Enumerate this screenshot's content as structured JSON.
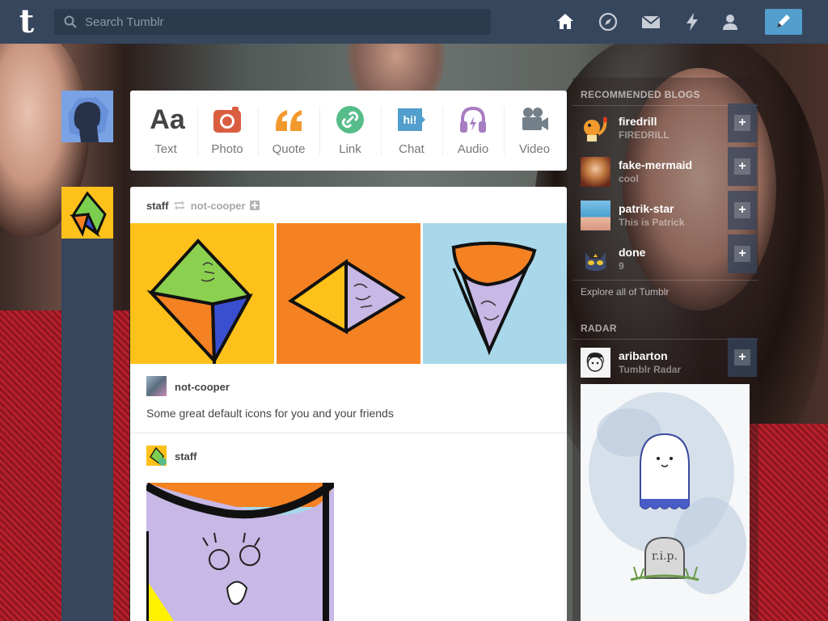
{
  "header": {
    "search_placeholder": "Search Tumblr",
    "logo_letter": "t"
  },
  "post_types": [
    {
      "label": "Text",
      "icon": "text-icon",
      "color": "#444444"
    },
    {
      "label": "Photo",
      "icon": "photo-icon",
      "color": "#d95e40"
    },
    {
      "label": "Quote",
      "icon": "quote-icon",
      "color": "#f2992e"
    },
    {
      "label": "Link",
      "icon": "link-icon",
      "color": "#56bc8a"
    },
    {
      "label": "Chat",
      "icon": "chat-icon",
      "color": "#529ecc"
    },
    {
      "label": "Audio",
      "icon": "audio-icon",
      "color": "#a77dc2"
    },
    {
      "label": "Video",
      "icon": "video-icon",
      "color": "#748089"
    }
  ],
  "post": {
    "author": "staff",
    "reblogged_from": "not-cooper",
    "source_name": "not-cooper",
    "body": "Some great default icons for you and your friends",
    "second_author": "staff"
  },
  "sidebar": {
    "recommended_title": "RECOMMENDED BLOGS",
    "blogs": [
      {
        "name": "firedrill",
        "subtitle": "FIREDRILL"
      },
      {
        "name": "fake-mermaid",
        "subtitle": "cool"
      },
      {
        "name": "patrik-star",
        "subtitle": "This is Patrick"
      },
      {
        "name": "done",
        "subtitle": "9"
      }
    ],
    "explore_label": "Explore all of Tumblr",
    "radar_title": "RADAR",
    "radar_blog": {
      "name": "aribarton",
      "subtitle": "Tumblr Radar"
    },
    "follow_symbol": "+"
  }
}
